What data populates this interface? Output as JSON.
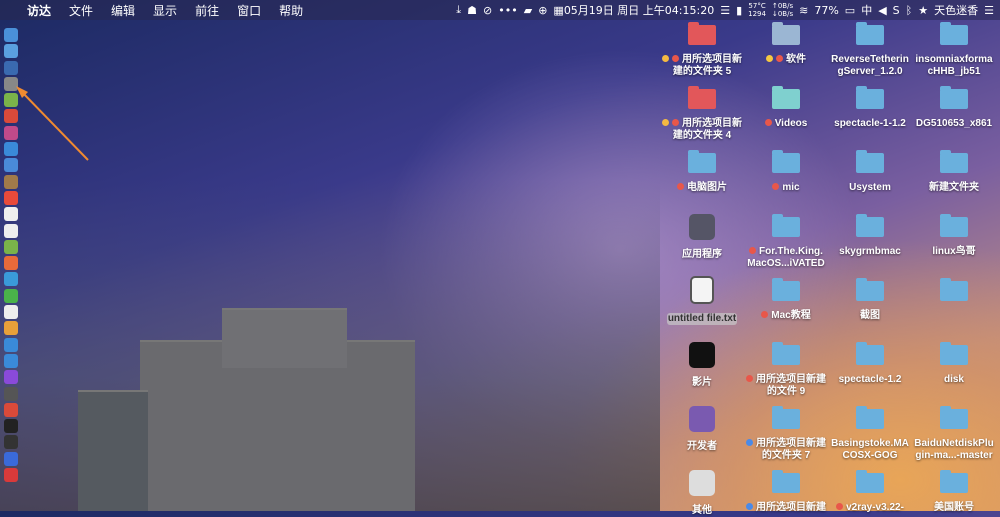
{
  "menubar": {
    "apple": "",
    "items": [
      "访达",
      "文件",
      "编辑",
      "显示",
      "前往",
      "窗口",
      "帮助"
    ],
    "datetime": "05月19日 周日 上午04:15:20",
    "temp": "57°C",
    "fan": "1294",
    "net_up": "↑0B/s",
    "net_down": "↓0B/s",
    "battery": "77%",
    "input_method": "中",
    "user": "天色迷香"
  },
  "dock_colors": [
    "#4a90d9",
    "#5aa0e0",
    "#3a6ab0",
    "#888",
    "#7ab34a",
    "#d94a3a",
    "#c04a8a",
    "#3a8ad9",
    "#4a8ad9",
    "#a07a4a",
    "#e84a3a",
    "#eee",
    "#eee",
    "#7ab34a",
    "#e86a3a",
    "#3a9ad9",
    "#4ab34a",
    "#eee",
    "#e8a03a",
    "#3a8ad9",
    "#3a8ad9",
    "#8a4ad9",
    "#555",
    "#d94a3a",
    "#222",
    "#333",
    "#3a6ad9",
    "#d93a3a"
  ],
  "desktop": [
    {
      "label": "用所选项目新建的文件夹 5",
      "kind": "folder-red",
      "tags": [
        "#f5b942",
        "#e8574a"
      ]
    },
    {
      "label": "软件",
      "kind": "folder-grey",
      "tags": [
        "#f5c842",
        "#e8574a"
      ]
    },
    {
      "label": "ReverseTetheringServer_1.2.0",
      "kind": "folder"
    },
    {
      "label": "insomniaxformacHHB_jb51",
      "kind": "folder"
    },
    {
      "label": "用所选项目新建的文件夹 4",
      "kind": "folder-red",
      "tags": [
        "#f5b942",
        "#e8574a"
      ]
    },
    {
      "label": "Videos",
      "kind": "folder-teal",
      "tags": [
        "#e8574a"
      ]
    },
    {
      "label": "spectacle-1-1.2",
      "kind": "folder"
    },
    {
      "label": "DG510653_x861",
      "kind": "folder"
    },
    {
      "label": "电脑图片",
      "kind": "folder",
      "tags": [
        "#e8574a"
      ]
    },
    {
      "label": "mic",
      "kind": "folder",
      "tags": [
        "#e8574a"
      ]
    },
    {
      "label": "Usystem",
      "kind": "folder"
    },
    {
      "label": "新建文件夹",
      "kind": "folder"
    },
    {
      "label": "应用程序",
      "kind": "app",
      "color": "#556"
    },
    {
      "label": "For.The.King.MacOS...iVATED",
      "kind": "folder",
      "tags": [
        "#e8574a"
      ]
    },
    {
      "label": "skygrmbmac",
      "kind": "folder"
    },
    {
      "label": "linux鸟哥",
      "kind": "folder"
    },
    {
      "label": "untitled file.txt",
      "kind": "file",
      "selected": true
    },
    {
      "label": "Mac教程",
      "kind": "folder",
      "tags": [
        "#e8574a"
      ]
    },
    {
      "label": "截图",
      "kind": "folder"
    },
    {
      "label": "",
      "kind": "folder"
    },
    {
      "label": "影片",
      "kind": "app",
      "color": "#111"
    },
    {
      "label": "用所选项目新建的文件 9",
      "kind": "folder",
      "tags": [
        "#e8574a"
      ]
    },
    {
      "label": "spectacle-1.2",
      "kind": "folder"
    },
    {
      "label": "disk",
      "kind": "folder"
    },
    {
      "label": "开发者",
      "kind": "app",
      "color": "#7a5ab0"
    },
    {
      "label": "用所选项目新建的文件夹 7",
      "kind": "folder",
      "tags": [
        "#4a8ae8"
      ]
    },
    {
      "label": "Basingstoke.MACOSX-GOG",
      "kind": "folder"
    },
    {
      "label": "BaiduNetdiskPlugin-ma...-master",
      "kind": "folder"
    },
    {
      "label": "其他",
      "kind": "app",
      "color": "#ddd"
    },
    {
      "label": "用所选项目新建",
      "kind": "folder",
      "tags": [
        "#4a8ae8"
      ]
    },
    {
      "label": "v2ray-v3.22-",
      "kind": "folder",
      "tags": [
        "#e8574a"
      ]
    },
    {
      "label": "美国账号",
      "kind": "folder"
    }
  ],
  "annotation_color": "#f08a30"
}
